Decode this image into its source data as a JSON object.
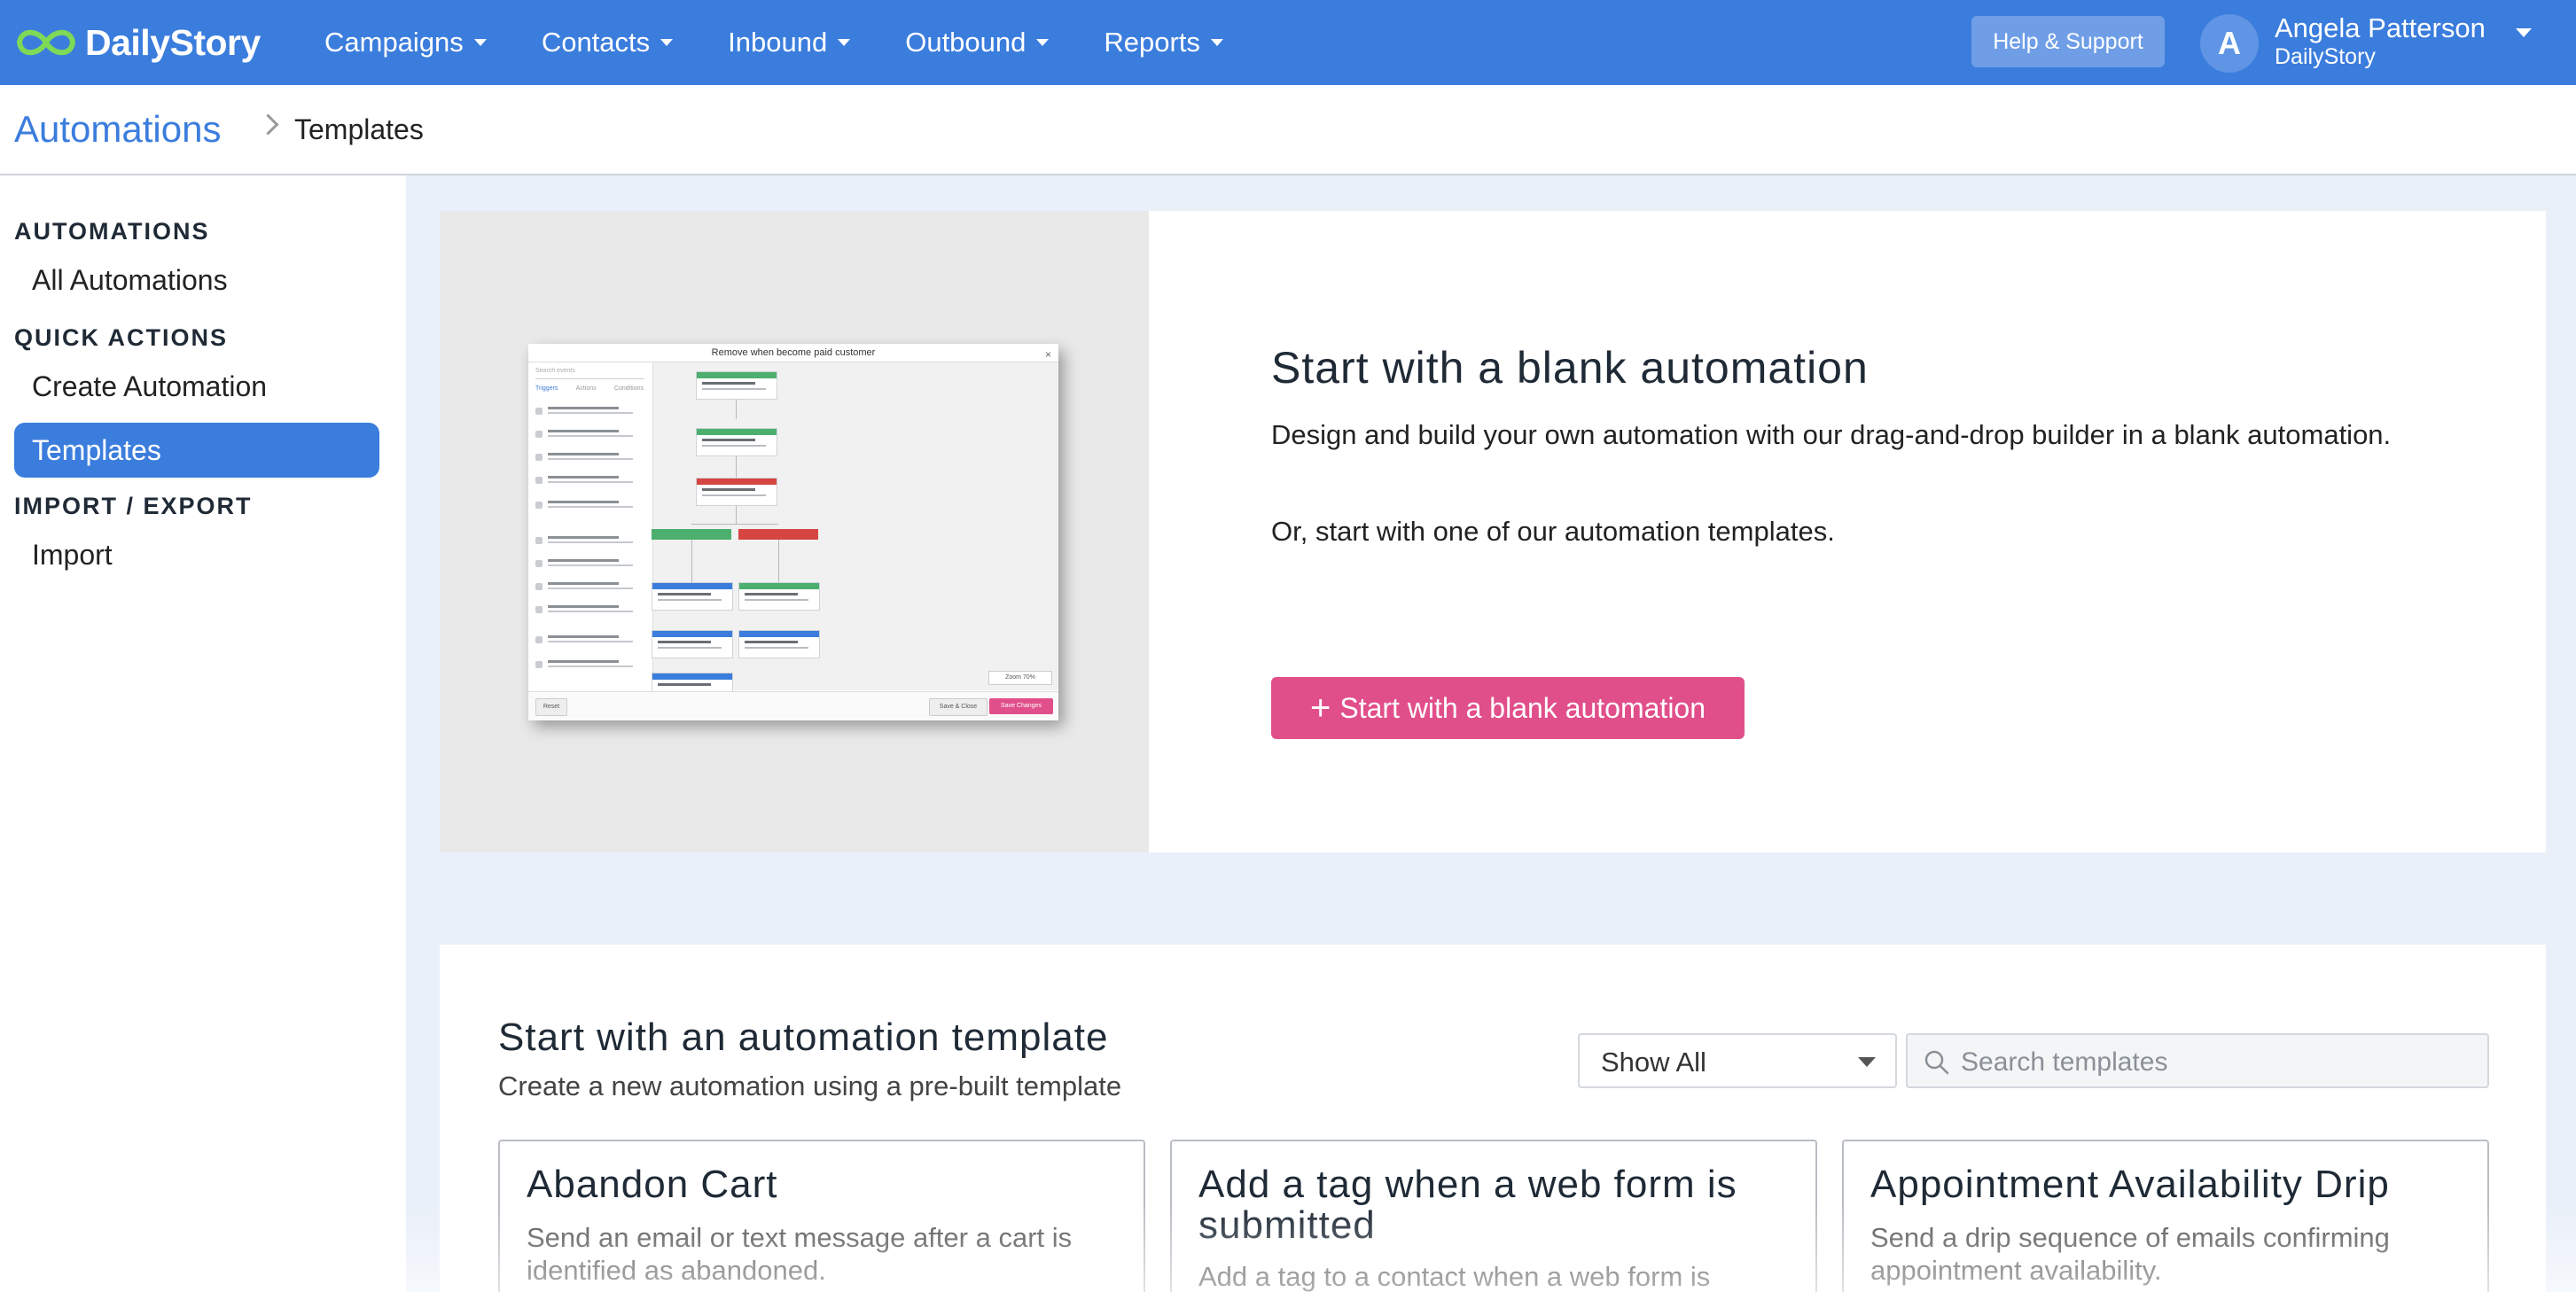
{
  "brand": {
    "name": "DailyStory"
  },
  "nav": {
    "items": [
      {
        "label": "Campaigns"
      },
      {
        "label": "Contacts"
      },
      {
        "label": "Inbound"
      },
      {
        "label": "Outbound"
      },
      {
        "label": "Reports"
      }
    ],
    "help_label": "Help & Support"
  },
  "user": {
    "initial": "A",
    "name": "Angela Patterson",
    "org": "DailyStory"
  },
  "breadcrumb": {
    "root": "Automations",
    "current": "Templates"
  },
  "sidebar": {
    "sections": [
      {
        "heading": "AUTOMATIONS",
        "items": [
          {
            "label": "All Automations"
          }
        ]
      },
      {
        "heading": "QUICK ACTIONS",
        "items": [
          {
            "label": "Create Automation"
          },
          {
            "label": "Templates",
            "active": true
          }
        ]
      },
      {
        "heading": "IMPORT / EXPORT",
        "items": [
          {
            "label": "Import"
          }
        ]
      }
    ]
  },
  "hero": {
    "title": "Start with a blank automation",
    "paragraph1": "Design and build your own automation with our drag-and-drop builder in a blank automation.",
    "paragraph2": "Or, start with one of our automation templates.",
    "button_label": "Start with a blank automation",
    "button_icon": "plus-icon",
    "preview": {
      "window_title": "Remove when become paid customer",
      "search_placeholder": "Search events",
      "tabs": [
        "Triggers",
        "Actions",
        "Conditions"
      ],
      "reset_label": "Reset",
      "save_close_label": "Save & Close",
      "save_label": "Save Changes",
      "zoom_label": "Zoom 70%"
    }
  },
  "templates": {
    "title": "Start with an automation template",
    "subtitle": "Create a new automation using a pre-built template",
    "filter_value": "Show All",
    "search_placeholder": "Search templates",
    "cards": [
      {
        "title": "Abandon Cart",
        "description": "Send an email or text message after a cart is identified as abandoned."
      },
      {
        "title": "Add a tag when a web form is submitted",
        "description": "Add a tag to a contact when a web form is submitted."
      },
      {
        "title": "Appointment Availability Drip",
        "description": "Send a drip sequence of emails confirming appointment availability."
      }
    ]
  },
  "colors": {
    "primary": "#3b7ddd",
    "accent_pink": "#e14f8b",
    "main_background": "#eaf0f9",
    "node_green": "#4caf6d",
    "node_red": "#d64541",
    "node_blue": "#3b7ddd"
  }
}
